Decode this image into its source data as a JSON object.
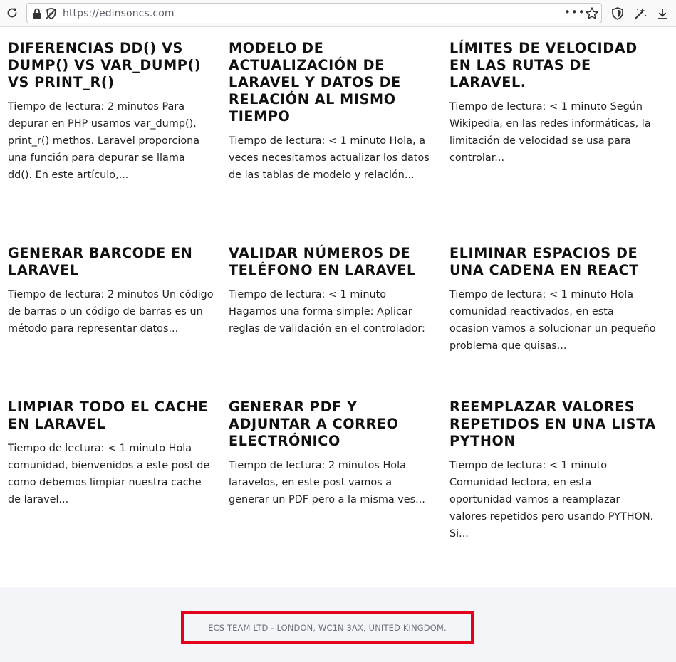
{
  "browser": {
    "url": "https://edinsoncs.com",
    "page_actions": "•••",
    "icons": [
      "reload-icon",
      "lock-icon",
      "tracking-protection-icon",
      "page-actions-icon",
      "bookmark-star-icon",
      "shield-icon",
      "customize-icon",
      "download-icon"
    ]
  },
  "posts": [
    {
      "title": "DIFERENCIAS DD() VS DUMP() VS VAR_DUMP() VS PRINT_R()",
      "excerpt": "Tiempo de lectura: 2 minutos Para depurar en PHP usamos var_dump(), print_r() methos. Laravel proporciona una función para depurar se llama dd(). En este artículo,..."
    },
    {
      "title": "MODELO DE ACTUALIZACIÓN DE LARAVEL Y DATOS DE RELACIÓN AL MISMO TIEMPO",
      "excerpt": "Tiempo de lectura: < 1 minuto Hola, a veces necesitamos actualizar los datos de las tablas de modelo y relación..."
    },
    {
      "title": "LÍMITES DE VELOCIDAD EN LAS RUTAS DE LARAVEL.",
      "excerpt": "Tiempo de lectura: < 1 minuto Según Wikipedia, en las redes informáticas, la limitación de velocidad se usa para controlar..."
    },
    {
      "title": "GENERAR BARCODE EN LARAVEL",
      "excerpt": "Tiempo de lectura: 2 minutos Un código de barras o un código de barras es un método para representar datos..."
    },
    {
      "title": "VALIDAR NÚMEROS DE TELÉFONO EN LARAVEL",
      "excerpt": "Tiempo de lectura: < 1 minuto Hagamos una forma simple: Aplicar reglas de validación en el controlador:"
    },
    {
      "title": "ELIMINAR ESPACIOS DE UNA CADENA EN REACT",
      "excerpt": "Tiempo de lectura: < 1 minuto Hola comunidad reactivados, en esta ocasion vamos a solucionar un pequeño problema que quisas..."
    },
    {
      "title": "LIMPIAR TODO EL CACHE EN LARAVEL",
      "excerpt": "Tiempo de lectura: < 1 minuto Hola comunidad, bienvenidos a este post de como debemos limpiar nuestra cache de laravel..."
    },
    {
      "title": "GENERAR PDF Y ADJUNTAR A CORREO ELECTRÓNICO",
      "excerpt": "Tiempo de lectura: 2 minutos Hola laravelos, en este post vamos a generar un PDF pero a la misma ves..."
    },
    {
      "title": "REEMPLAZAR VALORES REPETIDOS EN UNA LISTA PYTHON",
      "excerpt": "Tiempo de lectura: < 1 minuto Comunidad lectora, en esta oportunidad vamos a reamplazar valores repetidos pero usando PYTHON. Si..."
    }
  ],
  "footer": {
    "text": "ECS TEAM LTD - LONDON, WC1N 3AX, UNITED KINGDOM.",
    "highlight_color": "#e3001b"
  }
}
